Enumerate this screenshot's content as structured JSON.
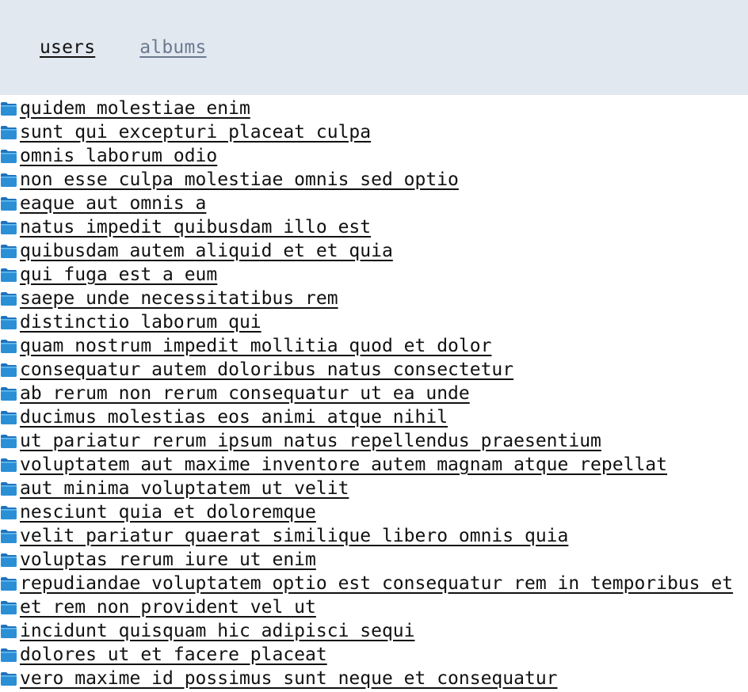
{
  "nav": {
    "users_label": "users",
    "albums_label": "albums",
    "active_color": "#111111",
    "inactive_color": "#6b7a90",
    "background": "#e2e8f0"
  },
  "icon": {
    "name": "folder-icon",
    "color": "#1e73be"
  },
  "albums": [
    "quidem molestiae enim",
    "sunt qui excepturi placeat culpa",
    "omnis laborum odio",
    "non esse culpa molestiae omnis sed optio",
    "eaque aut omnis a",
    "natus impedit quibusdam illo est",
    "quibusdam autem aliquid et et quia",
    "qui fuga est a eum",
    "saepe unde necessitatibus rem",
    "distinctio laborum qui",
    "quam nostrum impedit mollitia quod et dolor",
    "consequatur autem doloribus natus consectetur",
    "ab rerum non rerum consequatur ut ea unde",
    "ducimus molestias eos animi atque nihil",
    "ut pariatur rerum ipsum natus repellendus praesentium",
    "voluptatem aut maxime inventore autem magnam atque repellat",
    "aut minima voluptatem ut velit",
    "nesciunt quia et doloremque",
    "velit pariatur quaerat similique libero omnis quia",
    "voluptas rerum iure ut enim",
    "repudiandae voluptatem optio est consequatur rem in temporibus et",
    "et rem non provident vel ut",
    "incidunt quisquam hic adipisci sequi",
    "dolores ut et facere placeat",
    "vero maxime id possimus sunt neque et consequatur"
  ]
}
